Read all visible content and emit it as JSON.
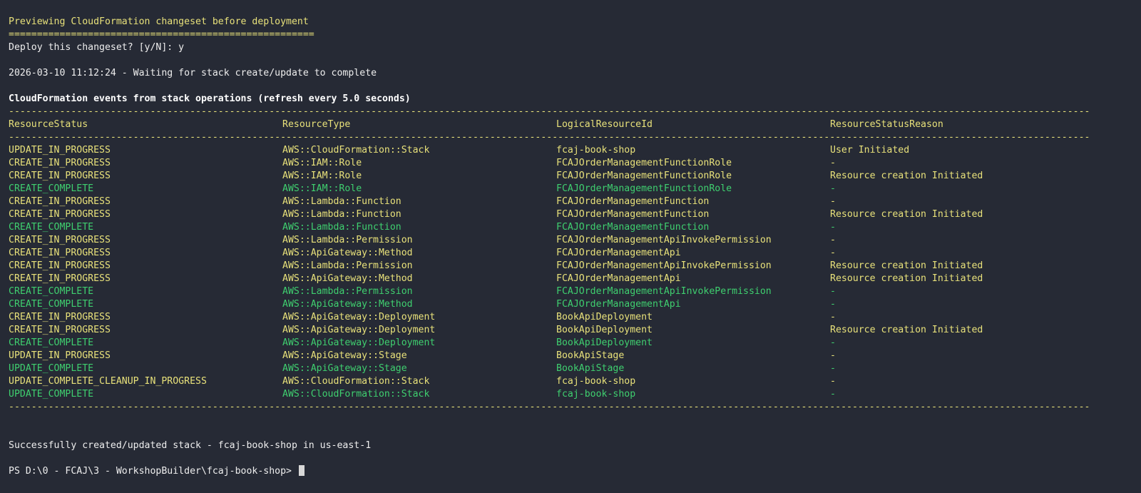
{
  "colors": {
    "background": "#262a35",
    "yellow": "#e8e17a",
    "green": "#3fcf6f",
    "white": "#eeeeee"
  },
  "preview": {
    "title": "Previewing CloudFormation changeset before deployment",
    "underline": "======================================================",
    "prompt": "Deploy this changeset? [y/N]: y"
  },
  "waiting": "2026-03-10 11:12:24 - Waiting for stack create/update to complete",
  "events_header": "CloudFormation events from stack operations (refresh every 5.0 seconds)",
  "separator": "-------------------------------------------------------------------------------------------------------------------------------------------------------------------------------------------------",
  "columns": [
    "ResourceStatus",
    "ResourceType",
    "LogicalResourceId",
    "ResourceStatusReason"
  ],
  "events": [
    {
      "status": "UPDATE_IN_PROGRESS",
      "type": "AWS::CloudFormation::Stack",
      "logical_id": "fcaj-book-shop",
      "reason": "User Initiated",
      "color": "yellow"
    },
    {
      "status": "CREATE_IN_PROGRESS",
      "type": "AWS::IAM::Role",
      "logical_id": "FCAJOrderManagementFunctionRole",
      "reason": "-",
      "color": "yellow"
    },
    {
      "status": "CREATE_IN_PROGRESS",
      "type": "AWS::IAM::Role",
      "logical_id": "FCAJOrderManagementFunctionRole",
      "reason": "Resource creation Initiated",
      "color": "yellow"
    },
    {
      "status": "CREATE_COMPLETE",
      "type": "AWS::IAM::Role",
      "logical_id": "FCAJOrderManagementFunctionRole",
      "reason": "-",
      "color": "green"
    },
    {
      "status": "CREATE_IN_PROGRESS",
      "type": "AWS::Lambda::Function",
      "logical_id": "FCAJOrderManagementFunction",
      "reason": "-",
      "color": "yellow"
    },
    {
      "status": "CREATE_IN_PROGRESS",
      "type": "AWS::Lambda::Function",
      "logical_id": "FCAJOrderManagementFunction",
      "reason": "Resource creation Initiated",
      "color": "yellow"
    },
    {
      "status": "CREATE_COMPLETE",
      "type": "AWS::Lambda::Function",
      "logical_id": "FCAJOrderManagementFunction",
      "reason": "-",
      "color": "green"
    },
    {
      "status": "CREATE_IN_PROGRESS",
      "type": "AWS::Lambda::Permission",
      "logical_id": "FCAJOrderManagementApiInvokePermission",
      "reason": "-",
      "color": "yellow"
    },
    {
      "status": "CREATE_IN_PROGRESS",
      "type": "AWS::ApiGateway::Method",
      "logical_id": "FCAJOrderManagementApi",
      "reason": "-",
      "color": "yellow"
    },
    {
      "status": "CREATE_IN_PROGRESS",
      "type": "AWS::Lambda::Permission",
      "logical_id": "FCAJOrderManagementApiInvokePermission",
      "reason": "Resource creation Initiated",
      "color": "yellow"
    },
    {
      "status": "CREATE_IN_PROGRESS",
      "type": "AWS::ApiGateway::Method",
      "logical_id": "FCAJOrderManagementApi",
      "reason": "Resource creation Initiated",
      "color": "yellow"
    },
    {
      "status": "CREATE_COMPLETE",
      "type": "AWS::Lambda::Permission",
      "logical_id": "FCAJOrderManagementApiInvokePermission",
      "reason": "-",
      "color": "green"
    },
    {
      "status": "CREATE_COMPLETE",
      "type": "AWS::ApiGateway::Method",
      "logical_id": "FCAJOrderManagementApi",
      "reason": "-",
      "color": "green"
    },
    {
      "status": "CREATE_IN_PROGRESS",
      "type": "AWS::ApiGateway::Deployment",
      "logical_id": "BookApiDeployment",
      "reason": "-",
      "color": "yellow"
    },
    {
      "status": "CREATE_IN_PROGRESS",
      "type": "AWS::ApiGateway::Deployment",
      "logical_id": "BookApiDeployment",
      "reason": "Resource creation Initiated",
      "color": "yellow"
    },
    {
      "status": "CREATE_COMPLETE",
      "type": "AWS::ApiGateway::Deployment",
      "logical_id": "BookApiDeployment",
      "reason": "-",
      "color": "green"
    },
    {
      "status": "UPDATE_IN_PROGRESS",
      "type": "AWS::ApiGateway::Stage",
      "logical_id": "BookApiStage",
      "reason": "-",
      "color": "yellow"
    },
    {
      "status": "UPDATE_COMPLETE",
      "type": "AWS::ApiGateway::Stage",
      "logical_id": "BookApiStage",
      "reason": "-",
      "color": "green"
    },
    {
      "status": "UPDATE_COMPLETE_CLEANUP_IN_PROGRESS",
      "type": "AWS::CloudFormation::Stack",
      "logical_id": "fcaj-book-shop",
      "reason": "-",
      "color": "yellow"
    },
    {
      "status": "UPDATE_COMPLETE",
      "type": "AWS::CloudFormation::Stack",
      "logical_id": "fcaj-book-shop",
      "reason": "-",
      "color": "green"
    }
  ],
  "success_message": "Successfully created/updated stack - fcaj-book-shop in us-east-1",
  "shell_prompt": "PS D:\\0 - FCAJ\\3 - WorkshopBuilder\\fcaj-book-shop> "
}
